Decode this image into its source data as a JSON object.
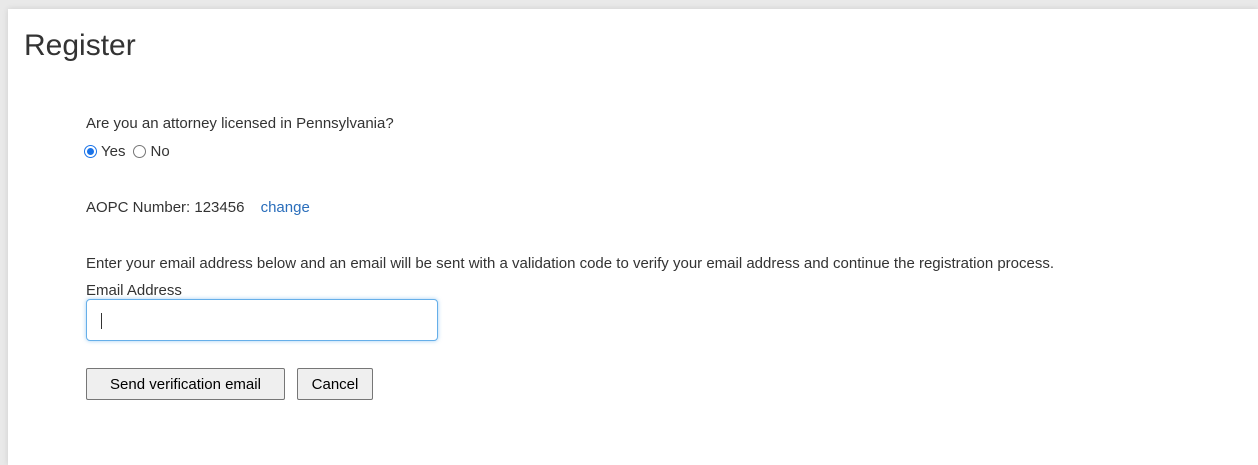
{
  "page": {
    "title": "Register"
  },
  "attorney_question": {
    "label": "Are you an attorney licensed in Pennsylvania?",
    "options": [
      {
        "label": "Yes",
        "checked": true
      },
      {
        "label": "No",
        "checked": false
      }
    ]
  },
  "aopc": {
    "label": "AOPC Number: 123456",
    "change_link": "change"
  },
  "email": {
    "instructions": "Enter your email address below and an email will be sent with a validation code to verify your email address and continue the registration process.",
    "label": "Email Address",
    "value": ""
  },
  "actions": {
    "send_label": "Send verification email",
    "cancel_label": "Cancel"
  },
  "colors": {
    "link": "#2a6ebb",
    "radio_accent": "#1a73e8",
    "input_focus_border": "#66afe9"
  }
}
